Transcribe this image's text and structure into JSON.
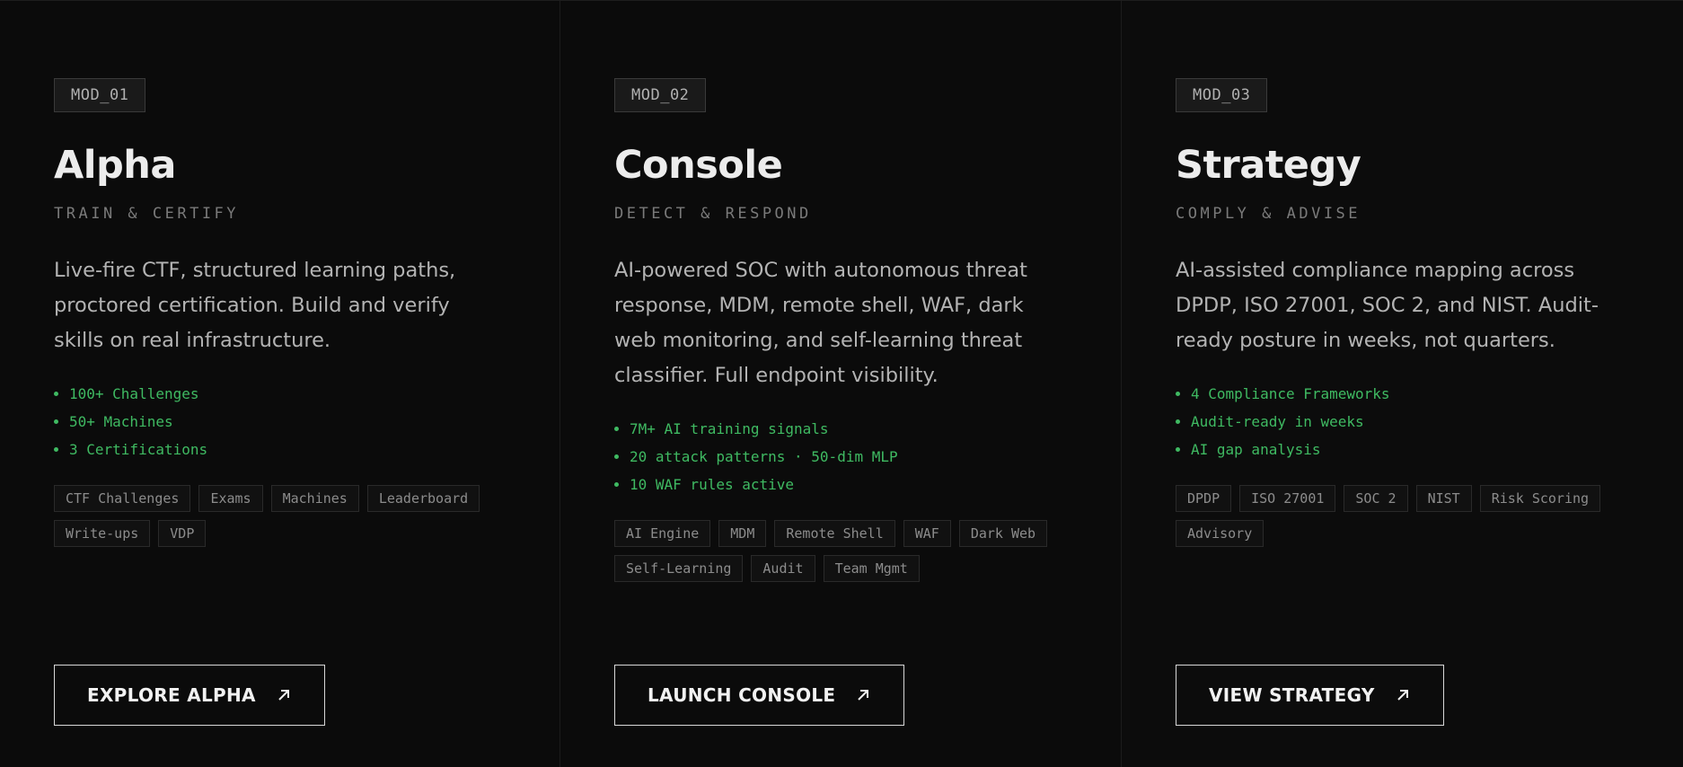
{
  "modules": [
    {
      "tag": "MOD_01",
      "title": "Alpha",
      "subtitle": "TRAIN & CERTIFY",
      "description": "Live-fire CTF, structured learning paths, proctored certification. Build and verify skills on real infrastructure.",
      "stats": [
        "100+ Challenges",
        "50+ Machines",
        "3 Certifications"
      ],
      "tags": [
        "CTF Challenges",
        "Exams",
        "Machines",
        "Leaderboard",
        "Write-ups",
        "VDP"
      ],
      "cta": "EXPLORE ALPHA"
    },
    {
      "tag": "MOD_02",
      "title": "Console",
      "subtitle": "DETECT & RESPOND",
      "description": "AI-powered SOC with autonomous threat response, MDM, remote shell, WAF, dark web monitoring, and self-learning threat classifier. Full endpoint visibility.",
      "stats": [
        "7M+ AI training signals",
        "20 attack patterns · 50-dim MLP",
        "10 WAF rules active"
      ],
      "tags": [
        "AI Engine",
        "MDM",
        "Remote Shell",
        "WAF",
        "Dark Web",
        "Self-Learning",
        "Audit",
        "Team Mgmt"
      ],
      "cta": "LAUNCH CONSOLE"
    },
    {
      "tag": "MOD_03",
      "title": "Strategy",
      "subtitle": "COMPLY & ADVISE",
      "description": "AI-assisted compliance mapping across DPDP, ISO 27001, SOC 2, and NIST. Audit-ready posture in weeks, not quarters.",
      "stats": [
        "4 Compliance Frameworks",
        "Audit-ready in weeks",
        "AI gap analysis"
      ],
      "tags": [
        "DPDP",
        "ISO 27001",
        "SOC 2",
        "NIST",
        "Risk Scoring",
        "Advisory"
      ],
      "cta": "VIEW STRATEGY"
    }
  ],
  "colors": {
    "background": "#0b0b0b",
    "accent_green": "#3fba62",
    "title": "#ececec",
    "muted": "#7a7a7a"
  },
  "icons": {
    "cta_arrow": "arrow-up-right-icon",
    "stat_bullet": "dot-icon"
  }
}
